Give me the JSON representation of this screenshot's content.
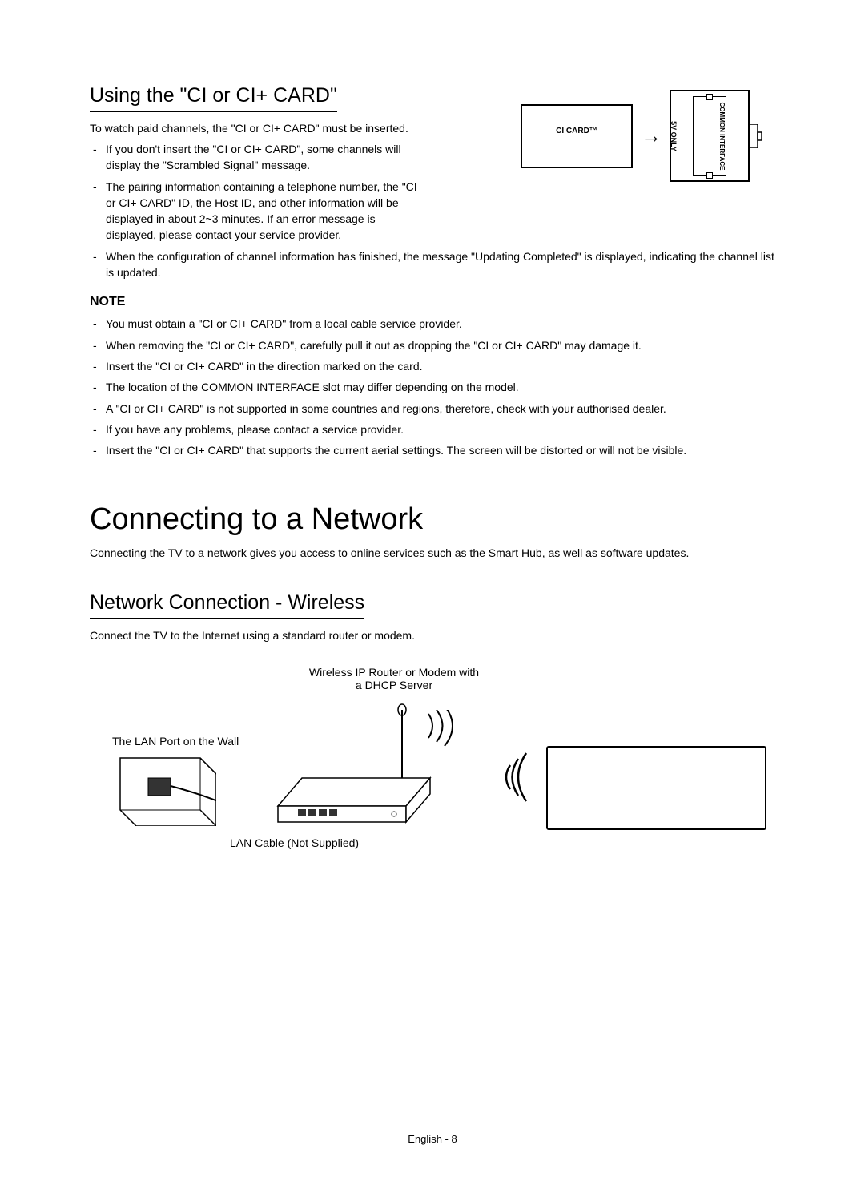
{
  "section1": {
    "title": "Using the \"CI or CI+ CARD\"",
    "intro": "To watch paid channels, the \"CI or CI+ CARD\" must be inserted.",
    "bullets_a": [
      "If you don't insert the \"CI or CI+ CARD\", some channels will display the \"Scrambled Signal\" message.",
      "The pairing information containing a telephone number, the \"CI or CI+ CARD\" ID, the Host ID, and other information will be displayed in about 2~3 minutes. If an error message is displayed, please contact your service provider."
    ],
    "bullets_b": [
      "When the configuration of channel information has finished, the message \"Updating Completed\" is displayed, indicating the channel list is updated."
    ],
    "note_label": "NOTE",
    "note_bullets": [
      "You must obtain a \"CI or CI+ CARD\" from a local cable service provider.",
      "When removing the \"CI or CI+ CARD\", carefully pull it out as dropping the \"CI or CI+ CARD\" may damage it.",
      "Insert the \"CI or CI+ CARD\" in the direction marked on the card.",
      "The location of the COMMON INTERFACE slot may differ depending on the model.",
      "A \"CI or CI+ CARD\" is not supported in some countries and regions, therefore, check with your authorised dealer.",
      "If you have any problems, please contact a service provider.",
      "Insert the \"CI or CI+ CARD\" that supports the current aerial settings. The screen will be distorted or will not be visible."
    ]
  },
  "diagram_ci": {
    "card_label": "CI CARD™",
    "slot_5v": "5V ONLY",
    "slot_ci": "COMMON INTERFACE"
  },
  "section2": {
    "h1": "Connecting to a Network",
    "intro": "Connecting the TV to a network gives you access to online services such as the Smart Hub, as well as software updates.",
    "subtitle": "Network Connection - Wireless",
    "subintro": "Connect the TV to the Internet using a standard router or modem."
  },
  "diagram_net": {
    "router_label_1": "Wireless IP Router or Modem with",
    "router_label_2": "a DHCP Server",
    "lan_wall": "The LAN Port on the Wall",
    "lan_cable": "LAN Cable (Not Supplied)"
  },
  "footer": "English - 8"
}
